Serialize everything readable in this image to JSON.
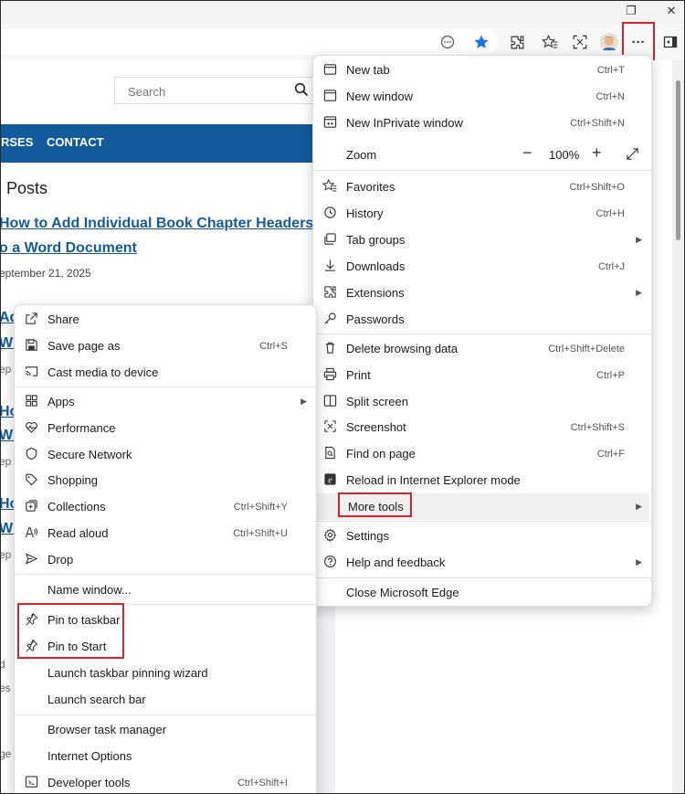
{
  "browser": {
    "window_controls": {
      "restore_icon": "❐",
      "close_icon": "✕"
    },
    "toolbar_icons": [
      "●",
      "★",
      "✸",
      "☆",
      "⬚",
      "…",
      "⊟"
    ],
    "settings_button_label": "···"
  },
  "website": {
    "search_placeholder": "Search",
    "nav": [
      "RSES",
      "CONTACT"
    ],
    "posts_heading": "Posts",
    "post_title_line1": "How to Add Individual Book Chapter Headers",
    "post_title_line2": "o a Word Document",
    "post_date": "eptember 21, 2025",
    "partial_fragments": [
      "Ad",
      "Wi",
      "ep",
      "Ho",
      "Wi",
      "ep",
      "Ho",
      "Wi",
      "ep",
      "d",
      "es",
      "ge"
    ]
  },
  "main_menu": {
    "items": [
      {
        "label": "New tab",
        "shortcut": "Ctrl+T"
      },
      {
        "label": "New window",
        "shortcut": "Ctrl+N"
      },
      {
        "label": "New InPrivate window",
        "shortcut": "Ctrl+Shift+N"
      },
      {
        "label": "Zoom",
        "value": "100%"
      },
      {
        "label": "Favorites",
        "shortcut": "Ctrl+Shift+O"
      },
      {
        "label": "History",
        "shortcut": "Ctrl+H"
      },
      {
        "label": "Tab groups"
      },
      {
        "label": "Downloads",
        "shortcut": "Ctrl+J"
      },
      {
        "label": "Extensions"
      },
      {
        "label": "Passwords"
      },
      {
        "label": "Delete browsing data",
        "shortcut": "Ctrl+Shift+Delete"
      },
      {
        "label": "Print",
        "shortcut": "Ctrl+P"
      },
      {
        "label": "Split screen"
      },
      {
        "label": "Screenshot",
        "shortcut": "Ctrl+Shift+S"
      },
      {
        "label": "Find on page",
        "shortcut": "Ctrl+F"
      },
      {
        "label": "Reload in Internet Explorer mode"
      },
      {
        "label": "More tools"
      },
      {
        "label": "Settings"
      },
      {
        "label": "Help and feedback"
      },
      {
        "label": "Close Microsoft Edge"
      }
    ]
  },
  "more_tools_menu": {
    "items": [
      {
        "label": "Share"
      },
      {
        "label": "Save page as",
        "shortcut": "Ctrl+S"
      },
      {
        "label": "Cast media to device"
      },
      {
        "label": "Apps"
      },
      {
        "label": "Performance"
      },
      {
        "label": "Secure Network"
      },
      {
        "label": "Shopping"
      },
      {
        "label": "Collections",
        "shortcut": "Ctrl+Shift+Y"
      },
      {
        "label": "Read aloud",
        "shortcut": "Ctrl+Shift+U"
      },
      {
        "label": "Drop"
      },
      {
        "label": "Name window..."
      },
      {
        "label": "Pin to taskbar"
      },
      {
        "label": "Pin to Start"
      },
      {
        "label": "Launch taskbar pinning wizard"
      },
      {
        "label": "Launch search bar"
      },
      {
        "label": "Browser task manager"
      },
      {
        "label": "Internet Options"
      },
      {
        "label": "Developer tools",
        "shortcut": "Ctrl+Shift+I"
      }
    ]
  },
  "colors": {
    "highlight": "#d9232e",
    "nav_blue": "#135b9b",
    "link_blue": "#135b9b",
    "star_blue": "#1a73e8"
  }
}
